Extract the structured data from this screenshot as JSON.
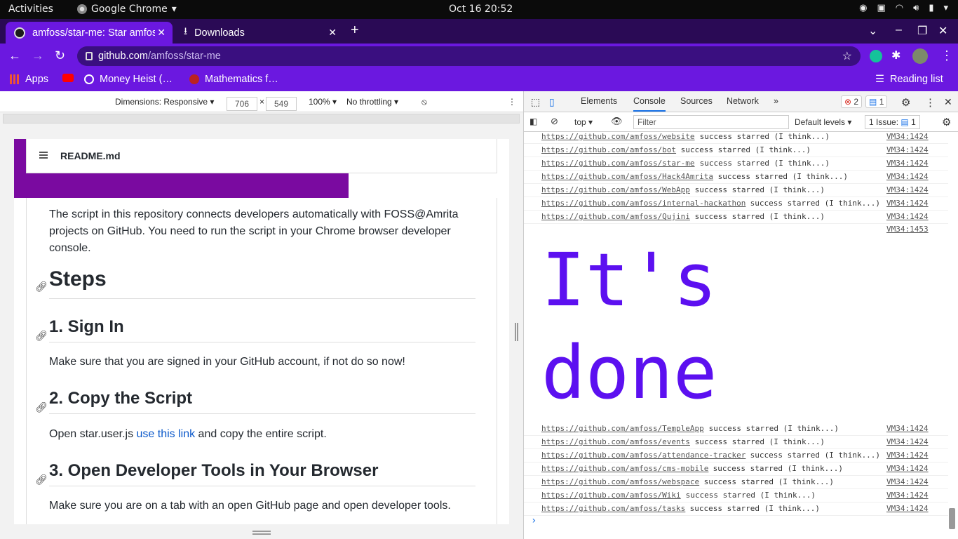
{
  "os": {
    "activities": "Activities",
    "app": "Google Chrome",
    "clock": "Oct 16  20:52"
  },
  "browser": {
    "tabs": [
      {
        "label": "amfoss/star-me: Star amfoss",
        "close": "✕"
      },
      {
        "label": "Downloads",
        "close": "✕"
      }
    ],
    "new_tab": "+",
    "url_host": "github.com",
    "url_path": "/amfoss/star-me",
    "bookmarks": [
      "Apps",
      "Money Heist (…",
      "Mathematics f…"
    ],
    "reading_list": "Reading list"
  },
  "devicebar": {
    "dimensions": "Dimensions: Responsive ▾",
    "width": "706",
    "height": "549",
    "times": "×",
    "zoom": "100% ▾",
    "throttle": "No throttling ▾",
    "more": "⋮"
  },
  "readme": {
    "file": "README.md",
    "intro": "The script in this repository connects developers automatically with FOSS@Amrita projects on GitHub. You need to run the script in your Chrome browser developer console.",
    "steps_heading": "Steps",
    "step1_heading": "1. Sign In",
    "step1_text": "Make sure that you are signed in your GitHub account, if not do so now!",
    "step2_heading": "2. Copy the Script",
    "step2_pre": "Open star.user.js ",
    "step2_link": "use this link",
    "step2_post": " and copy the entire script.",
    "step3_heading": "3. Open Developer Tools in Your Browser",
    "step3_text": "Make sure you are on a tab with an open GitHub page and open developer tools."
  },
  "devtools": {
    "tabs": [
      "Elements",
      "Console",
      "Sources",
      "Network",
      "»"
    ],
    "errors": "2",
    "messages": "1",
    "context": "top ▾",
    "filter_placeholder": "Filter",
    "levels": "Default levels ▾",
    "issues": "1 Issue:",
    "issues_count": "1",
    "logs_before": [
      {
        "url": "https://github.com/amfoss/website",
        "msg": " success starred (I think...)",
        "src": "VM34:1424"
      },
      {
        "url": "https://github.com/amfoss/bot",
        "msg": " success starred (I think...)",
        "src": "VM34:1424"
      },
      {
        "url": "https://github.com/amfoss/star-me",
        "msg": " success starred (I think...)",
        "src": "VM34:1424"
      },
      {
        "url": "https://github.com/amfoss/Hack4Amrita",
        "msg": " success starred (I think...)",
        "src": "VM34:1424"
      },
      {
        "url": "https://github.com/amfoss/WebApp",
        "msg": " success starred (I think...)",
        "src": "VM34:1424"
      },
      {
        "url": "https://github.com/amfoss/internal-hackathon",
        "msg": " success starred (I think...)",
        "src": "VM34:1424"
      },
      {
        "url": "https://github.com/amfoss/Qujini",
        "msg": " success starred (I think...)",
        "src": "VM34:1424"
      }
    ],
    "big_src": "VM34:1453",
    "big_line1": "It's",
    "big_line2": "done",
    "logs_after": [
      {
        "url": "https://github.com/amfoss/TempleApp",
        "msg": " success starred (I think...)",
        "src": "VM34:1424"
      },
      {
        "url": "https://github.com/amfoss/events",
        "msg": " success starred (I think...)",
        "src": "VM34:1424"
      },
      {
        "url": "https://github.com/amfoss/attendance-tracker",
        "msg": " success starred (I think...)",
        "src": "VM34:1424"
      },
      {
        "url": "https://github.com/amfoss/cms-mobile",
        "msg": " success starred (I think...)",
        "src": "VM34:1424"
      },
      {
        "url": "https://github.com/amfoss/webspace",
        "msg": " success starred (I think...)",
        "src": "VM34:1424"
      },
      {
        "url": "https://github.com/amfoss/Wiki",
        "msg": " success starred (I think...)",
        "src": "VM34:1424"
      },
      {
        "url": "https://github.com/amfoss/tasks",
        "msg": " success starred (I think...)",
        "src": "VM34:1424"
      }
    ],
    "prompt": "›"
  }
}
